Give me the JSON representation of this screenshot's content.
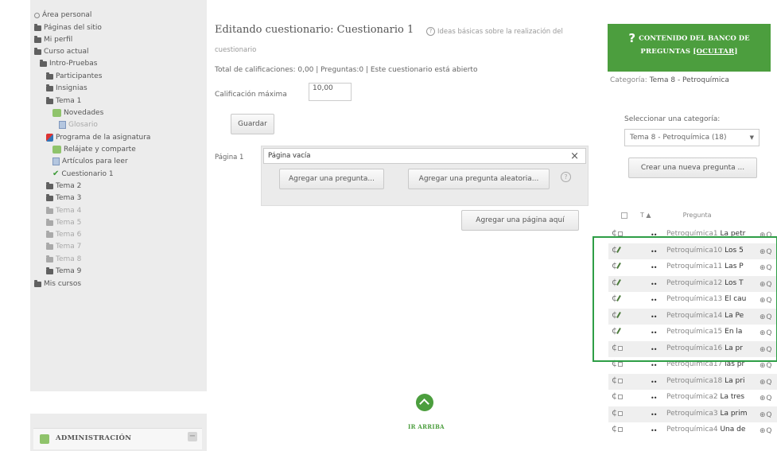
{
  "nav": {
    "items": [
      {
        "label": "Área personal",
        "icon": "ring-icon",
        "style": "normal"
      },
      {
        "label": "Páginas del sitio",
        "icon": "folder-icon",
        "style": "normal"
      },
      {
        "label": "Mi perfil",
        "icon": "folder-icon",
        "style": "normal"
      },
      {
        "label": "Curso actual",
        "icon": "folder-icon",
        "style": "normal"
      },
      {
        "label": "Intro-Pruebas",
        "icon": "folder-icon",
        "style": "normal"
      },
      {
        "label": "Participantes",
        "icon": "folder-icon",
        "style": "normal"
      },
      {
        "label": "Insignias",
        "icon": "folder-icon",
        "style": "normal"
      },
      {
        "label": "Tema 1",
        "icon": "folder-icon",
        "style": "normal"
      },
      {
        "label": "Novedades",
        "icon": "forum-icon",
        "style": "normal"
      },
      {
        "label": "Glosario",
        "icon": "page-icon",
        "style": "dim"
      },
      {
        "label": "Programa de la asignatura",
        "icon": "pin-icon",
        "style": "normal"
      },
      {
        "label": "Relájate y comparte",
        "icon": "forum-icon",
        "style": "normal"
      },
      {
        "label": "Artículos para leer",
        "icon": "page-icon",
        "style": "normal"
      },
      {
        "label": "Cuestionario 1",
        "icon": "quiz-icon",
        "style": "normal"
      },
      {
        "label": "Tema 2",
        "icon": "folder-icon",
        "style": "normal"
      },
      {
        "label": "Tema 3",
        "icon": "folder-icon",
        "style": "normal"
      },
      {
        "label": "Tema 4",
        "icon": "folder-icon",
        "style": "dim"
      },
      {
        "label": "Tema 5",
        "icon": "folder-icon",
        "style": "dim"
      },
      {
        "label": "Tema 6",
        "icon": "folder-icon",
        "style": "dim"
      },
      {
        "label": "Tema 7",
        "icon": "folder-icon",
        "style": "dim"
      },
      {
        "label": "Tema 8",
        "icon": "folder-icon",
        "style": "dim"
      },
      {
        "label": "Tema 9",
        "icon": "folder-icon",
        "style": "normal"
      },
      {
        "label": "Mis cursos",
        "icon": "folder-icon",
        "style": "normal"
      }
    ]
  },
  "admin": {
    "title": "ADMINISTRACIÓN",
    "collapse_label": "−"
  },
  "main": {
    "title": "Editando cuestionario: Cuestionario 1",
    "info_link_1": "Ideas básicas sobre la realización del",
    "info_link_2": "cuestionario",
    "totals": "Total de calificaciones: 0,00 | Preguntas:0 | Este cuestionario está abierto",
    "max_grade_label": "Calificación máxima",
    "max_grade_value": "10,00",
    "save_label": "Guardar",
    "page_label": "Página 1",
    "page_title_value": "Página vacía",
    "close_glyph": "×",
    "add_question_label": "Agregar una pregunta...",
    "add_random_label": "Agregar una pregunta aleatoria...",
    "help_glyph": "?",
    "add_page_label": "Agregar una página aquí",
    "go_up_label": "IR ARRIBA"
  },
  "bank": {
    "heading_line1": "CONTENIDO DEL BANCO DE",
    "heading_line2_prefix": "PREGUNTAS ",
    "heading_hide": "[OCULTAR]",
    "heading_icon": "?",
    "category_prefix": "Categoría: ",
    "category_value": "Tema 8 - Petroquímica",
    "select_label": "Seleccionar una categoría:",
    "select_value": "Tema 8 - Petroquímica (18)",
    "new_question_label": "Crear una nueva pregunta ...",
    "sort_label": "T ▲",
    "column_label": "Pregunta",
    "questions": [
      {
        "prefix": "Petroquímica1",
        "text": "La petr",
        "icon": "cb"
      },
      {
        "prefix": "Petroquímica10",
        "text": "Los 5",
        "icon": "edit"
      },
      {
        "prefix": "Petroquímica11",
        "text": "Las P",
        "icon": "edit"
      },
      {
        "prefix": "Petroquímica12",
        "text": "Los T",
        "icon": "edit"
      },
      {
        "prefix": "Petroquímica13",
        "text": "El cau",
        "icon": "edit"
      },
      {
        "prefix": "Petroquímica14",
        "text": "La Pe",
        "icon": "edit"
      },
      {
        "prefix": "Petroquímica15",
        "text": "En la",
        "icon": "edit"
      },
      {
        "prefix": "Petroquímica16",
        "text": "La pr",
        "icon": "cb"
      },
      {
        "prefix": "Petroquímica17",
        "text": "las pr",
        "icon": "cb"
      },
      {
        "prefix": "Petroquímica18",
        "text": "La pri",
        "icon": "cb"
      },
      {
        "prefix": "Petroquímica2",
        "text": "La tres",
        "icon": "cb"
      },
      {
        "prefix": "Petroquímica3",
        "text": "La prim",
        "icon": "cb"
      },
      {
        "prefix": "Petroquímica4",
        "text": "Una de",
        "icon": "cb"
      }
    ],
    "row_action_dots": "••",
    "row_action_icons": "⊕ Q"
  },
  "colors": {
    "accent_green": "#4c9e3e",
    "highlight_green": "#2e9e46",
    "sidebar_bg": "#ececec"
  }
}
